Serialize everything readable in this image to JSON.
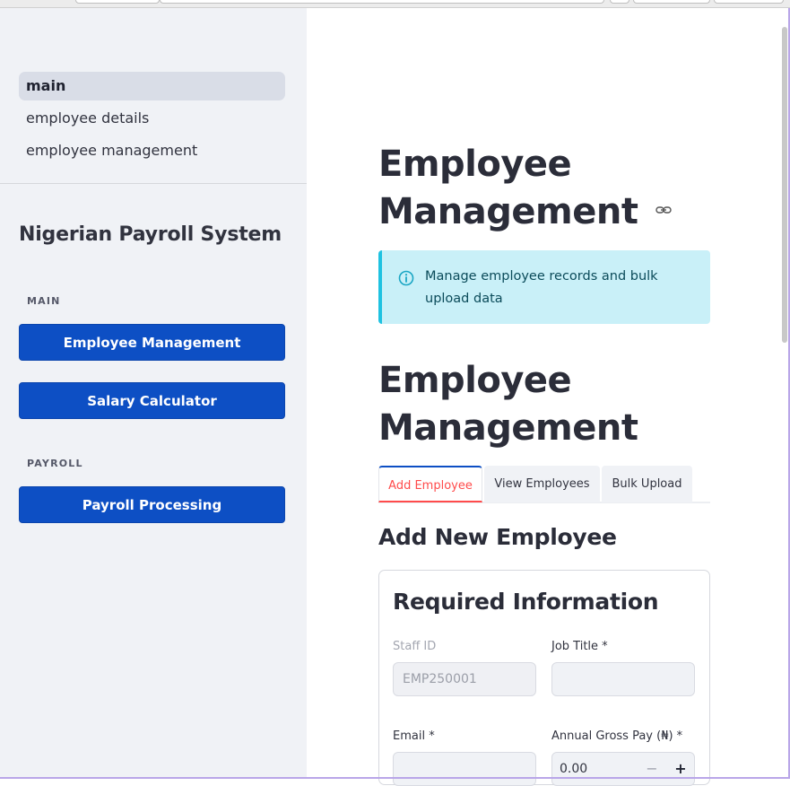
{
  "sidebar": {
    "nav": [
      {
        "label": "main",
        "active": true
      },
      {
        "label": "employee details",
        "active": false
      },
      {
        "label": "employee management",
        "active": false
      }
    ],
    "title": "Nigerian Payroll System",
    "sections": [
      {
        "label": "MAIN",
        "buttons": [
          "Employee Management",
          "Salary Calculator"
        ]
      },
      {
        "label": "PAYROLL",
        "buttons": [
          "Payroll Processing"
        ]
      }
    ]
  },
  "main": {
    "page_heading_line1": "Employee",
    "page_heading_line2": "Management",
    "info_text": "Manage employee records and bulk upload data",
    "section_heading_line1": "Employee",
    "section_heading_line2": "Management",
    "tabs": [
      {
        "label": "Add Employee",
        "active": true
      },
      {
        "label": "View Employees",
        "active": false
      },
      {
        "label": "Bulk Upload",
        "active": false
      }
    ],
    "subheading": "Add New Employee",
    "form": {
      "title": "Required Information",
      "staff_id_label": "Staff ID",
      "staff_id_value": "EMP250001",
      "job_title_label": "Job Title *",
      "job_title_value": "",
      "email_label": "Email *",
      "email_value": "",
      "gross_pay_label": "Annual Gross Pay (₦) *",
      "gross_pay_value": "0.00",
      "minus": "−",
      "plus": "+"
    }
  },
  "colors": {
    "accent": "#0d4fc4",
    "tab_active": "#ff4b4b",
    "info_bg": "#c9f0f8",
    "info_border": "#1fc2e1",
    "sidebar_bg": "#f0f2f6"
  },
  "icons": {
    "heading_link": "link-icon",
    "info": "info-icon"
  }
}
